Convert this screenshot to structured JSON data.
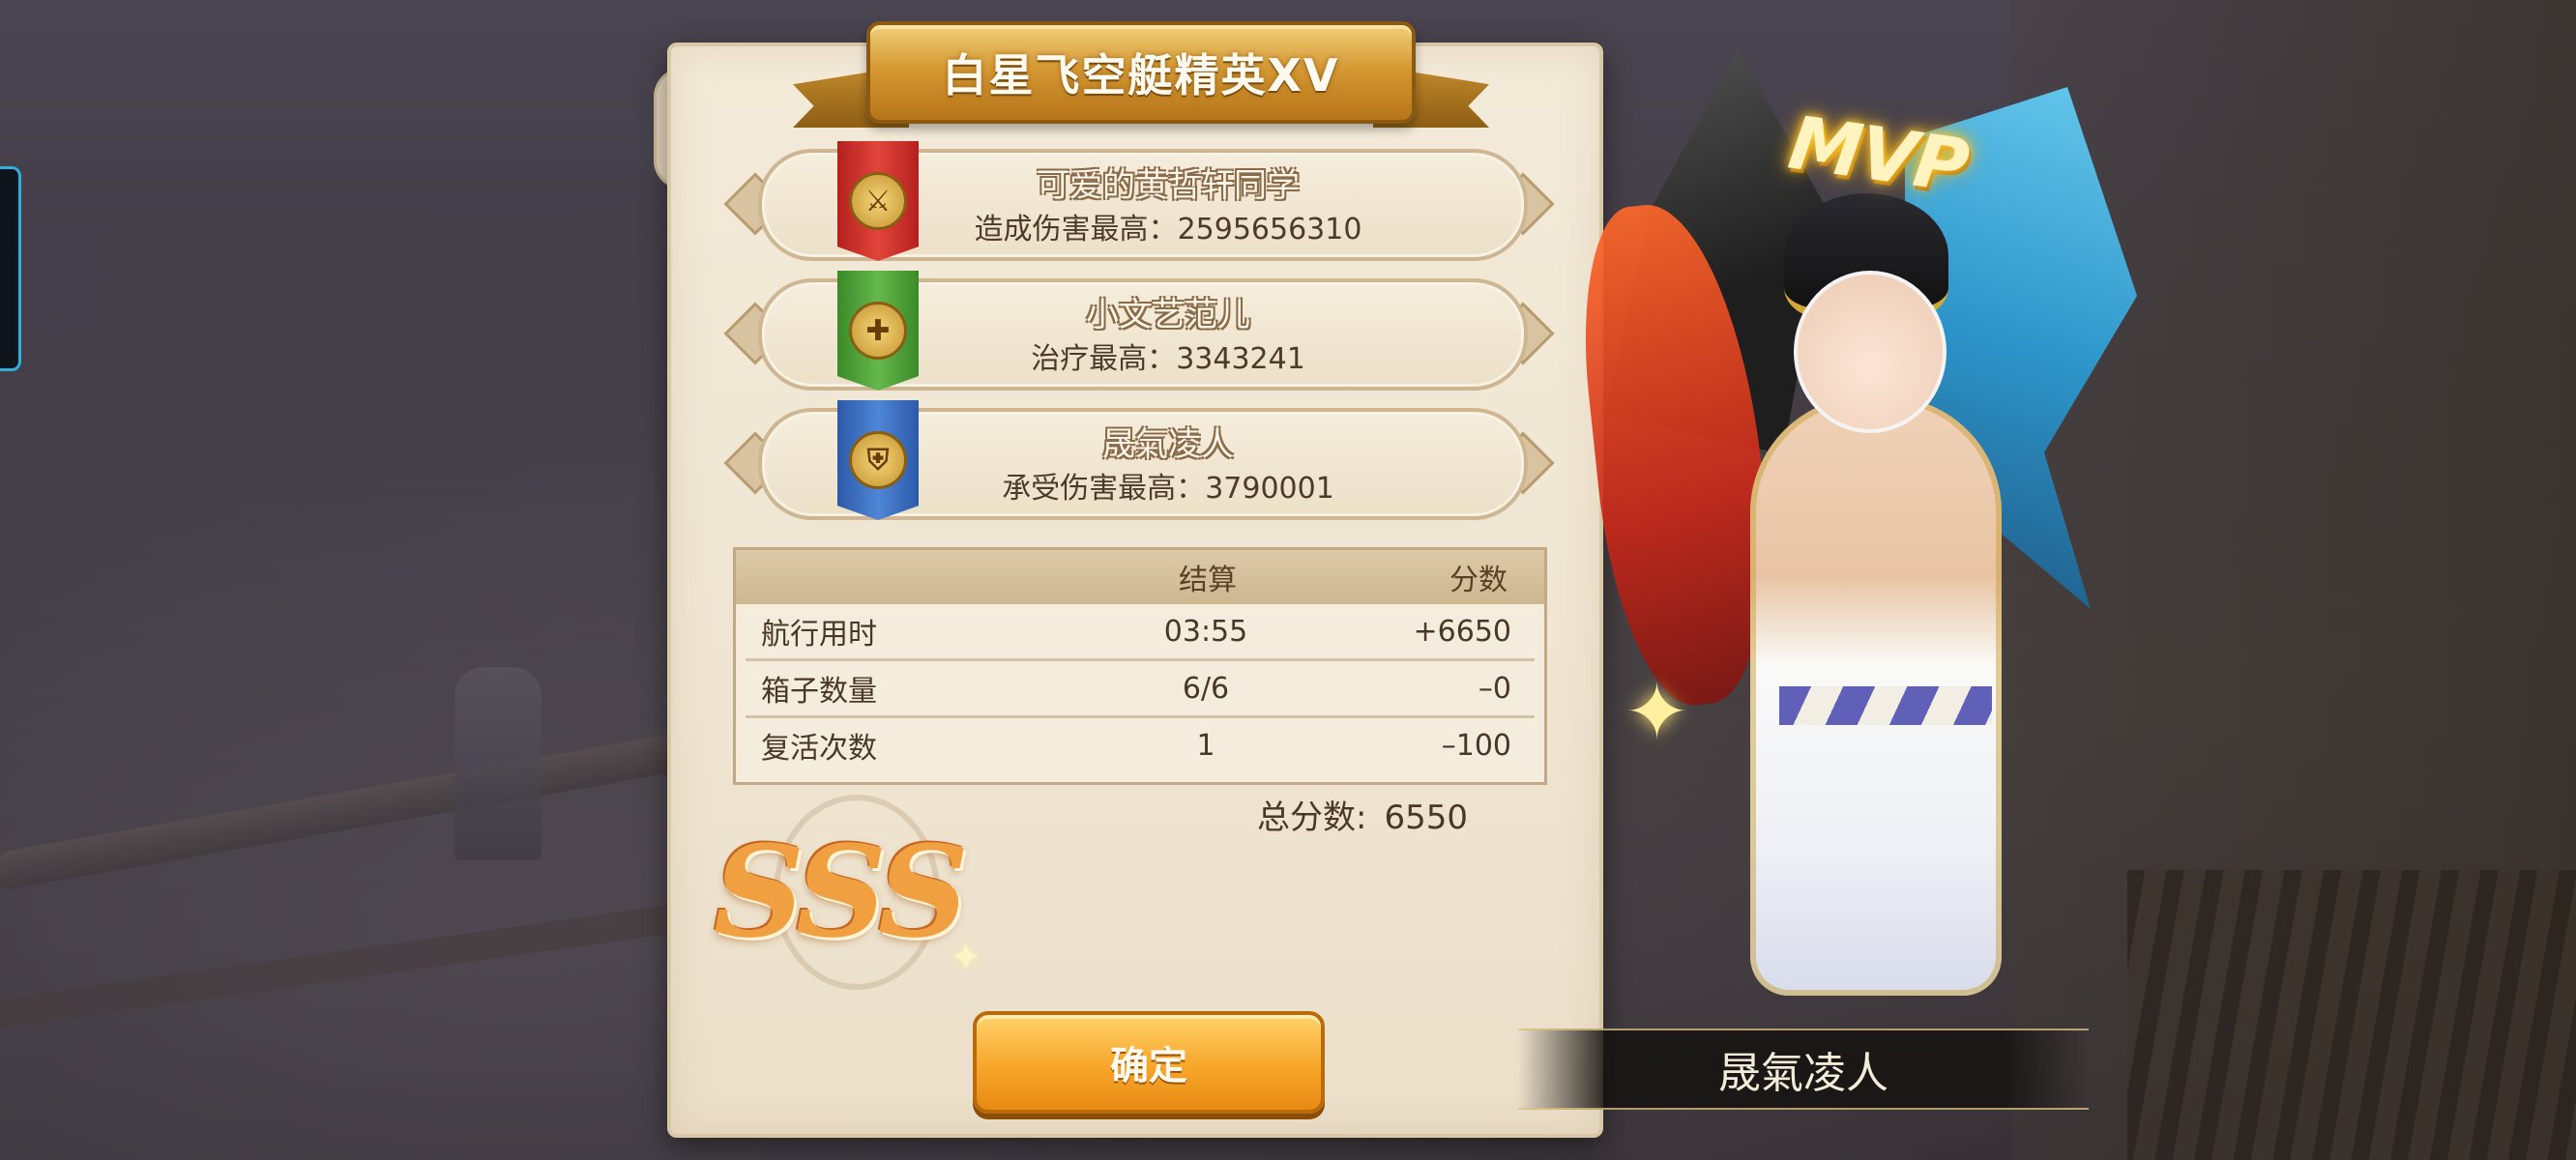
{
  "title": "白星飞空艇精英XV",
  "awards": [
    {
      "player": "可爱的黄哲轩同学",
      "stat_label": "造成伤害最高：",
      "stat_value": "2595656310",
      "badge_icon": "crossed-swords-icon",
      "badge_color": "#d0322c"
    },
    {
      "player": "小文艺范儿",
      "stat_label": "治疗最高：",
      "stat_value": "3343241",
      "badge_icon": "healing-cross-icon",
      "badge_color": "#4ea23a"
    },
    {
      "player": "晟氣凌人",
      "stat_label": "承受伤害最高：",
      "stat_value": "3790001",
      "badge_icon": "shield-icon",
      "badge_color": "#3c72c2"
    }
  ],
  "score_table": {
    "headers": {
      "item": "",
      "result": "结算",
      "score": "分数"
    },
    "rows": [
      {
        "item": "航行用时",
        "result": "03:55",
        "score": "+6650"
      },
      {
        "item": "箱子数量",
        "result": "6/6",
        "score": "–0"
      },
      {
        "item": "复活次数",
        "result": "1",
        "score": "–100"
      }
    ]
  },
  "total": {
    "label": "总分数:",
    "value": "6550"
  },
  "grade": "SSS",
  "confirm_label": "确定",
  "mvp": {
    "badge": "MVP",
    "player_name": "晟氣凌人"
  },
  "colors": {
    "accent_gold": "#d69a34",
    "button_orange": "#f7a62a",
    "parchment": "#f3ead9"
  }
}
